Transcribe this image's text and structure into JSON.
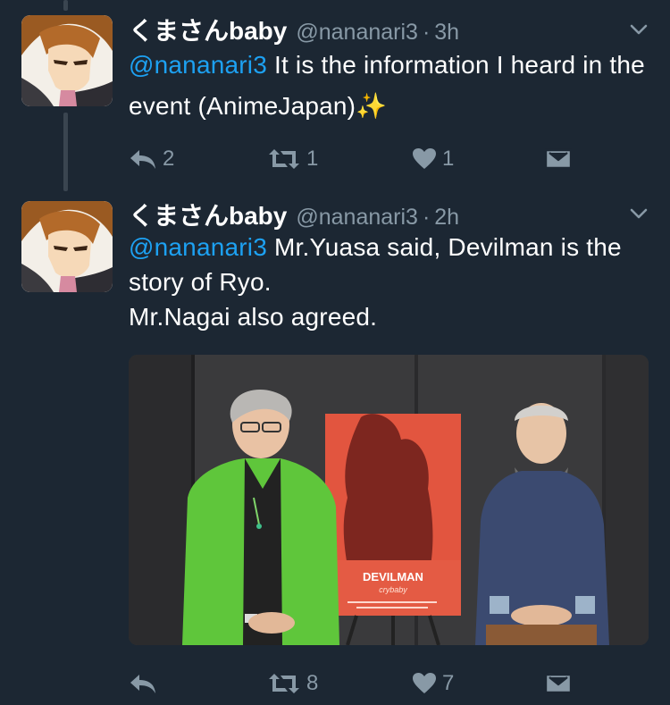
{
  "colors": {
    "background": "#1c2733",
    "text": "#ffffff",
    "muted": "#8899a6",
    "link": "#1da1f2"
  },
  "tweets": [
    {
      "author_name": "くまさんbaby",
      "handle": "@nananari3",
      "separator": "·",
      "time": "3h",
      "mention": "@nananari3",
      "body": " It is the information I heard in the event (AnimeJapan)",
      "emoji": "✨",
      "reply_count": "2",
      "retweet_count": "1",
      "like_count": "1",
      "icons": [
        "reply-icon",
        "retweet-icon",
        "heart-icon",
        "direct-message-icon",
        "chevron-down-icon"
      ]
    },
    {
      "author_name": "くまさんbaby",
      "handle": "@nananari3",
      "separator": "·",
      "time": "2h",
      "mention": "@nananari3",
      "body_line1": " Mr.Yuasa said, Devilman is the story of Ryo.",
      "body_line2": "Mr.Nagai also agreed.",
      "media": {
        "poster_title": "DEVILMAN",
        "poster_subtitle": "crybaby"
      },
      "retweet_count": "8",
      "like_count": "7",
      "icons": [
        "reply-icon",
        "retweet-icon",
        "heart-icon",
        "direct-message-icon",
        "chevron-down-icon"
      ]
    }
  ]
}
